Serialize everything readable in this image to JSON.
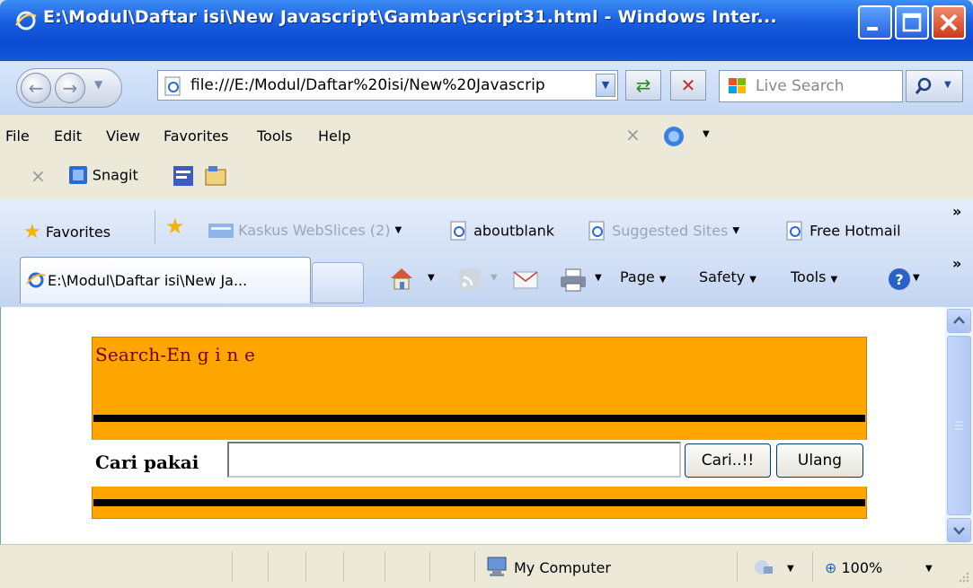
{
  "window": {
    "title": "E:\\Modul\\Daftar isi\\New Javascript\\Gambar\\script31.html - Windows Inter..."
  },
  "address": {
    "url": "file:///E:/Modul/Daftar%20isi/New%20Javascrip",
    "search_placeholder": "Live Search"
  },
  "menu": [
    "File",
    "Edit",
    "View",
    "Favorites",
    "Tools",
    "Help"
  ],
  "toolbar": {
    "snagit_label": "Snagit"
  },
  "favorites_bar": {
    "favorites_label": "Favorites",
    "items": [
      "Kaskus WebSlices (2)",
      "aboutblank",
      "Suggested Sites",
      "Free Hotmail"
    ],
    "overflow": "»"
  },
  "tab": {
    "label": "E:\\Modul\\Daftar isi\\New Ja..."
  },
  "command_bar": {
    "page_label": "Page",
    "safety_label": "Safety",
    "tools_label": "Tools",
    "overflow": "»"
  },
  "page": {
    "heading": "Search-En g i n e",
    "search_label": "Cari pakai",
    "search_value": "",
    "submit_button": "Cari..!!",
    "reset_button": "Ulang"
  },
  "status_bar": {
    "zone": "My Computer",
    "zoom": "100%"
  },
  "colors": {
    "title_bar": "#1a5fe0",
    "page_panel": "#ffa500",
    "heading_text": "#700000"
  }
}
